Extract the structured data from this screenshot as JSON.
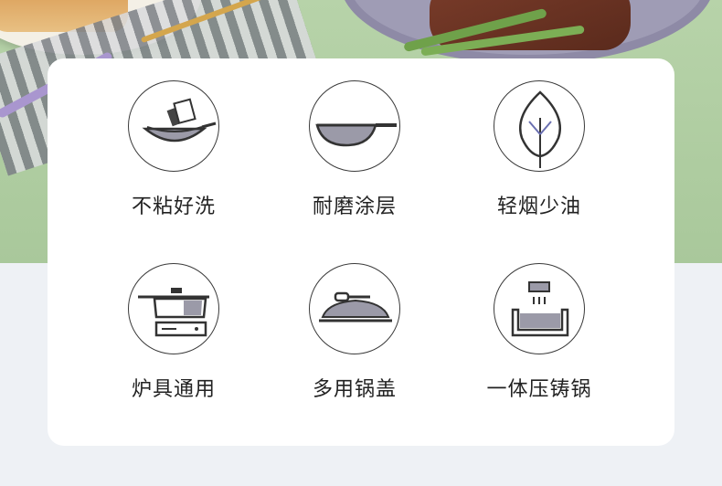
{
  "features": [
    {
      "label": "不粘好洗",
      "icon": "non-stick-pan-icon"
    },
    {
      "label": "耐磨涂层",
      "icon": "wok-coating-icon"
    },
    {
      "label": "轻烟少油",
      "icon": "leaf-icon"
    },
    {
      "label": "炉具通用",
      "icon": "stove-pot-icon"
    },
    {
      "label": "多用锅盖",
      "icon": "pan-lid-icon"
    },
    {
      "label": "一体压铸锅",
      "icon": "die-cast-pan-icon"
    }
  ]
}
